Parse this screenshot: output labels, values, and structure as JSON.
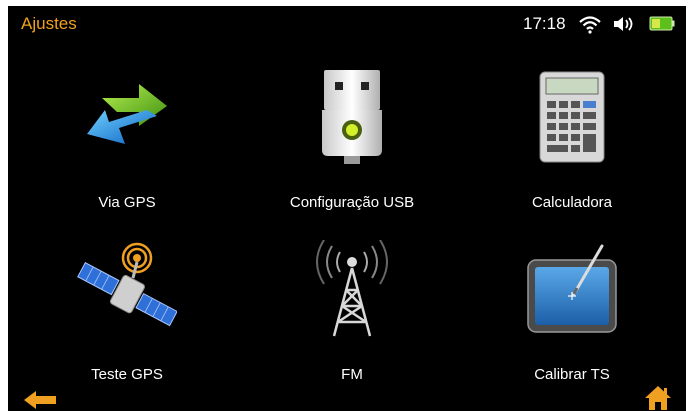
{
  "header": {
    "title": "Ajustes",
    "time": "17:18"
  },
  "status_icons": [
    "wifi-icon",
    "volume-icon",
    "battery-icon"
  ],
  "tiles": [
    {
      "label": "Via GPS",
      "icon": "gps-route-icon"
    },
    {
      "label": "Configuração USB",
      "icon": "usb-icon"
    },
    {
      "label": "Calculadora",
      "icon": "calculator-icon"
    },
    {
      "label": "Teste GPS",
      "icon": "satellite-icon"
    },
    {
      "label": "FM",
      "icon": "radio-tower-icon"
    },
    {
      "label": "Calibrar TS",
      "icon": "touchscreen-calibrate-icon"
    }
  ],
  "footer": {
    "back_icon": "back-arrow-icon",
    "home_icon": "home-icon"
  },
  "colors": {
    "accent": "#f0a020",
    "background": "#000000",
    "text": "#ffffff",
    "battery": "#7ed321"
  }
}
